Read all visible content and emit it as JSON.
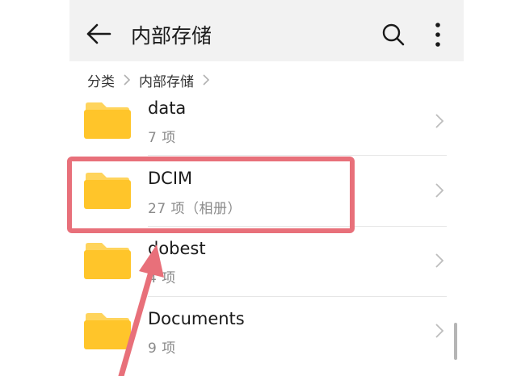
{
  "header": {
    "title": "内部存储",
    "back_icon": "arrow-left-icon",
    "search_icon": "search-icon",
    "more_icon": "more-vertical-icon"
  },
  "breadcrumb": {
    "items": [
      "分类",
      "内部存储"
    ]
  },
  "folders": [
    {
      "name": "data",
      "meta": "7 项"
    },
    {
      "name": "DCIM",
      "meta": "27 项（相册）"
    },
    {
      "name": "dobest",
      "meta": "4 项"
    },
    {
      "name": "Documents",
      "meta": "9 项"
    }
  ],
  "colors": {
    "folder": "#FFC52A",
    "folder_tab": "#FFD45C",
    "highlight": "#E8707A",
    "arrow": "#E8707A"
  }
}
